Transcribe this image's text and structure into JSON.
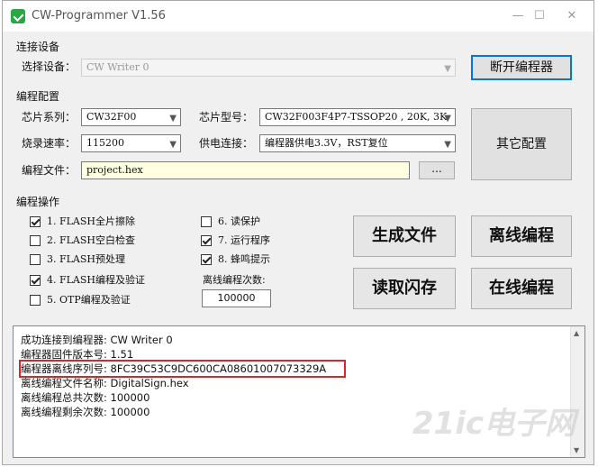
{
  "window": {
    "title": "CW-Programmer V1.56",
    "minimize": "—",
    "maximize": "☐",
    "close": "✕"
  },
  "connect": {
    "group_label": "连接设备",
    "device_label": "选择设备：",
    "device_value": "CW Writer 0",
    "disconnect_button": "断开编程器"
  },
  "config": {
    "group_label": "编程配置",
    "chip_series_label": "芯片系列：",
    "chip_series_value": "CW32F00",
    "chip_model_label": "芯片型号：",
    "chip_model_value": "CW32F003F4P7-TSSOP20 , 20K, 3K",
    "baud_label": "烧录速率：",
    "baud_value": "115200",
    "power_label": "供电连接：",
    "power_value": "编程器供电3.3V，RST复位",
    "file_label": "编程文件：",
    "file_value": "project.hex",
    "browse_button": "...",
    "other_button": "其它配置"
  },
  "operations": {
    "group_label": "编程操作",
    "options_left": [
      {
        "label": "1. FLASH全片擦除",
        "checked": true
      },
      {
        "label": "2. FLASH空白检查",
        "checked": false
      },
      {
        "label": "3. FLASH预处理",
        "checked": false
      },
      {
        "label": "4. FLASH编程及验证",
        "checked": true
      },
      {
        "label": "5. OTP编程及验证",
        "checked": false
      }
    ],
    "options_right": [
      {
        "label": "6. 读保护",
        "checked": false
      },
      {
        "label": "7. 运行程序",
        "checked": true
      },
      {
        "label": "8. 蜂鸣提示",
        "checked": true
      }
    ],
    "offline_count_label": "离线编程次数:",
    "offline_count_value": "100000",
    "buttons": {
      "generate": "生成文件",
      "offline": "离线编程",
      "read_flash": "读取闪存",
      "online": "在线编程"
    }
  },
  "log": {
    "lines": [
      "成功连接到编程器: CW Writer 0",
      "编程器固件版本号: 1.51",
      "编程器离线序列号: 8FC39C53C9DC600CA08601007073329A",
      "离线编程文件名称: DigitalSign.hex",
      "离线编程总共次数: 100000",
      "离线编程剩余次数: 100000"
    ]
  },
  "watermark": "21ic电子网"
}
